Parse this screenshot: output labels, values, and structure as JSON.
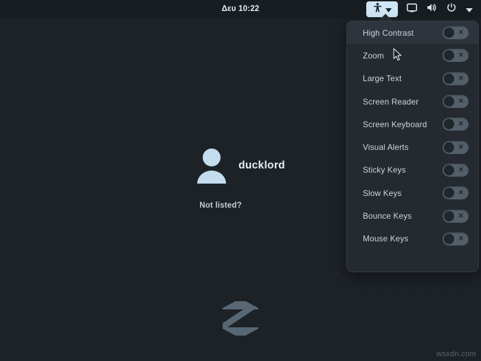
{
  "topbar": {
    "clock": "Δευ 10:22",
    "tray": [
      {
        "name": "accessibility-menu-button",
        "icon": "accessibility-icon",
        "active": true,
        "chevron": true
      },
      {
        "name": "display-button",
        "icon": "display-icon",
        "active": false,
        "chevron": false
      },
      {
        "name": "volume-button",
        "icon": "volume-icon",
        "active": false,
        "chevron": false
      },
      {
        "name": "power-button",
        "icon": "power-icon",
        "active": false,
        "chevron": false
      },
      {
        "name": "system-menu-button",
        "icon": "chevron-down-icon",
        "active": false,
        "chevron": false
      }
    ]
  },
  "accessibility_menu": {
    "items": [
      {
        "label": "High Contrast",
        "state": "off",
        "highlighted": true
      },
      {
        "label": "Zoom",
        "state": "off",
        "highlighted": false
      },
      {
        "label": "Large Text",
        "state": "off",
        "highlighted": false
      },
      {
        "label": "Screen Reader",
        "state": "off",
        "highlighted": false
      },
      {
        "label": "Screen Keyboard",
        "state": "off",
        "highlighted": false
      },
      {
        "label": "Visual Alerts",
        "state": "off",
        "highlighted": false
      },
      {
        "label": "Sticky Keys",
        "state": "off",
        "highlighted": false
      },
      {
        "label": "Slow Keys",
        "state": "off",
        "highlighted": false
      },
      {
        "label": "Bounce Keys",
        "state": "off",
        "highlighted": false
      },
      {
        "label": "Mouse Keys",
        "state": "off",
        "highlighted": false
      }
    ],
    "toggle_off_glyph": "✕"
  },
  "login": {
    "username": "ducklord",
    "not_listed_label": "Not listed?",
    "avatar_icon": "user-avatar-icon"
  },
  "branding": {
    "logo_icon": "zorin-logo-icon"
  },
  "watermark": "wsxdn.com",
  "colors": {
    "background": "#1d2227",
    "panel": "#242a30",
    "accent": "#cfe6f7",
    "avatar": "#c3ddef",
    "text": "#e8eef3",
    "muted_text": "#ccd6de",
    "switch_track": "#535f69",
    "switch_knob": "#1f262c"
  }
}
